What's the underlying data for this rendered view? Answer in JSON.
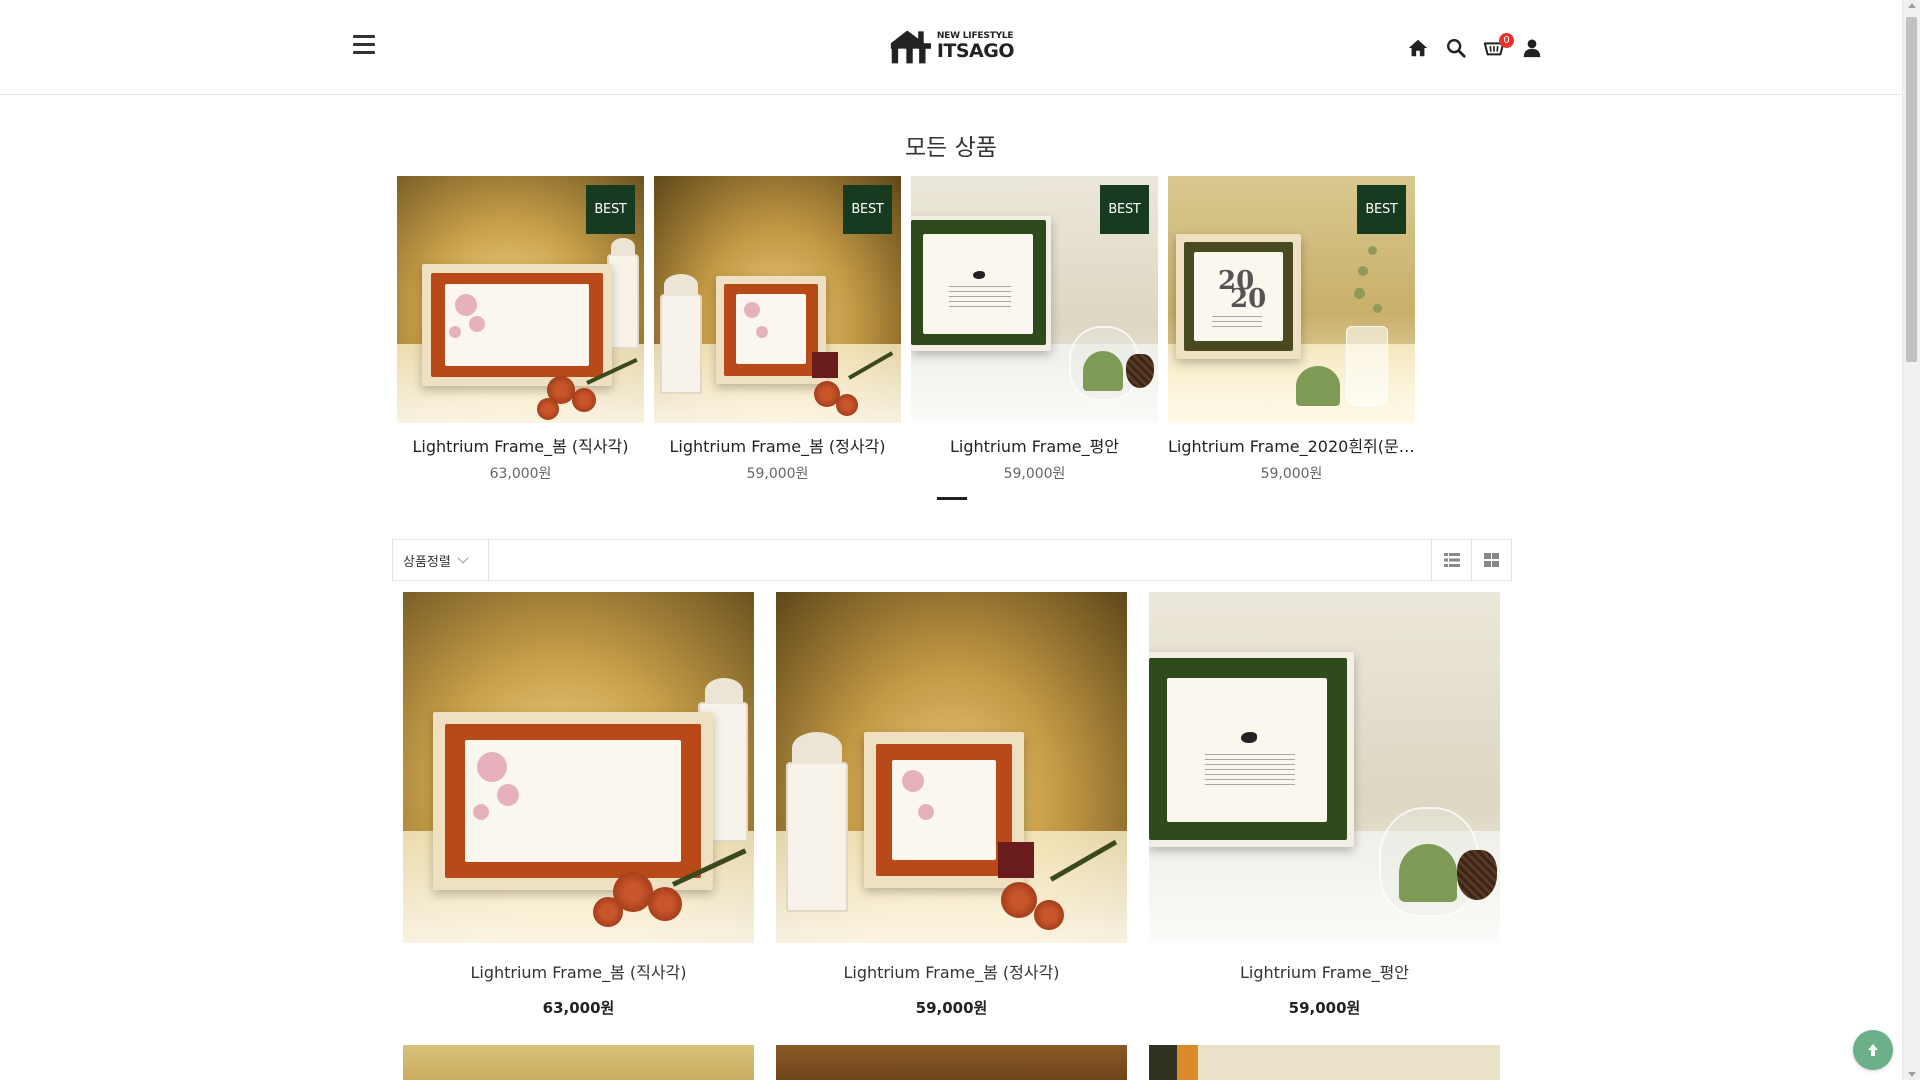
{
  "header": {
    "logo_sub": "NEW LIFESTYLE",
    "logo_main": "ITSAGO",
    "cart_count": "0"
  },
  "icons": {
    "menu": "hamburger-menu-icon",
    "home": "home-icon",
    "search": "search-icon",
    "cart": "cart-icon",
    "user": "user-icon",
    "list_view": "list-view-icon",
    "grid_view": "grid-view-icon",
    "top": "arrow-up-icon"
  },
  "page": {
    "title": "모든 상품"
  },
  "best": {
    "badge": "BEST",
    "items": [
      {
        "name": "Lightrium Frame_봄 (직사각)",
        "price": "63,000원"
      },
      {
        "name": "Lightrium Frame_봄 (정사각)",
        "price": "59,000원"
      },
      {
        "name": "Lightrium Frame_평안",
        "price": "59,000원"
      },
      {
        "name": "Lightrium Frame_2020흰쥐(문구…",
        "price": "59,000원"
      }
    ]
  },
  "sort": {
    "label": "상품정렬"
  },
  "products": [
    {
      "name": "Lightrium Frame_봄 (직사각)",
      "price": "63,000원"
    },
    {
      "name": "Lightrium Frame_봄 (정사각)",
      "price": "59,000원"
    },
    {
      "name": "Lightrium Frame_평안",
      "price": "59,000원"
    }
  ],
  "colors": {
    "badge_bg": "#163b21",
    "cart_badge": "#e8322e",
    "to_top_bg": "#6cb08a"
  }
}
